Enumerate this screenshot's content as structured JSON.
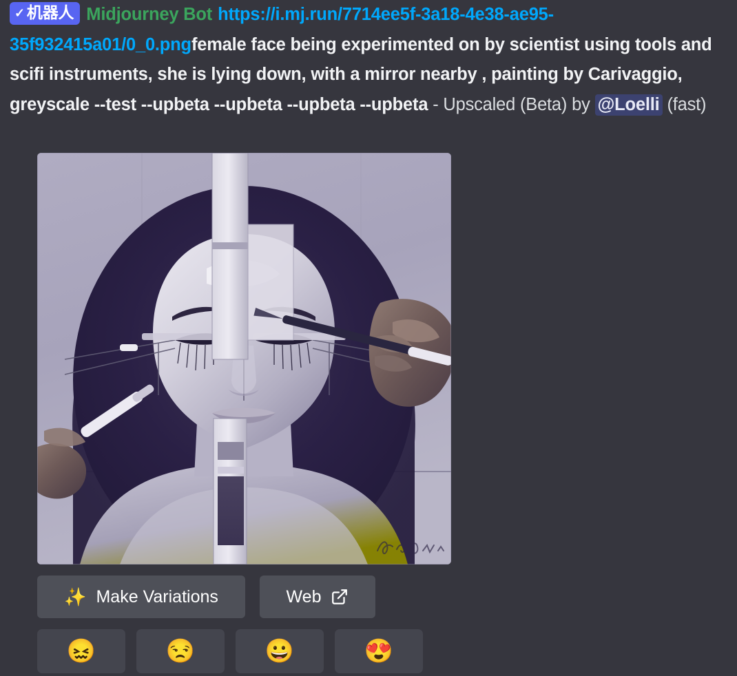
{
  "message": {
    "bot_badge": {
      "check": "✓",
      "label": "机器人"
    },
    "author": "Midjourney Bot",
    "image_url": "https://i.mj.run/7714ee5f-3a18-4e38-ae95-35f932415a01/0_0.png",
    "prompt": "female face being experimented on by scientist using tools and scifi instruments, she is lying down, with a mirror nearby , painting by Carivaggio, greyscale --test --upbeta --upbeta --upbeta --upbeta",
    "status_prefix": " - Upscaled (Beta) by ",
    "mention": "@Loelli",
    "speed": " (fast)"
  },
  "attachment": {
    "alt": "greyscale painting of a female face being experimented on with scifi instruments"
  },
  "actions": [
    {
      "id": "make-variations",
      "label": "Make Variations",
      "icon": "magic-wand-icon"
    },
    {
      "id": "web",
      "label": "Web",
      "icon": "external-link-icon"
    }
  ],
  "reactions": [
    {
      "id": "confounded",
      "emoji": "😖",
      "name": "confounded-face-emoji"
    },
    {
      "id": "unamused",
      "emoji": "😒",
      "name": "unamused-face-emoji"
    },
    {
      "id": "grinning",
      "emoji": "😀",
      "name": "grinning-face-emoji"
    },
    {
      "id": "heart-eyes",
      "emoji": "😍",
      "name": "smiling-face-with-hearts-emoji"
    }
  ],
  "colors": {
    "background": "#36363e",
    "bot_badge": "#5865f2",
    "author": "#3ba55d",
    "link": "#00a8fc",
    "mention_bg": "#3c4270",
    "button_bg": "#4e5058",
    "reaction_bg": "#44454e"
  }
}
